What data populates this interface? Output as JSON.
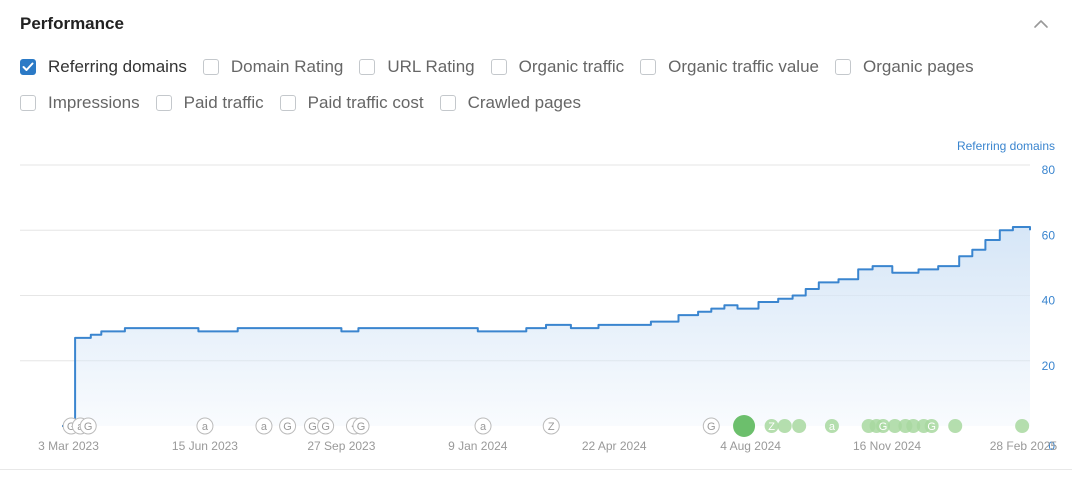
{
  "header": {
    "title": "Performance"
  },
  "metrics": [
    {
      "label": "Referring domains",
      "checked": true
    },
    {
      "label": "Domain Rating",
      "checked": false
    },
    {
      "label": "URL Rating",
      "checked": false
    },
    {
      "label": "Organic traffic",
      "checked": false
    },
    {
      "label": "Organic traffic value",
      "checked": false
    },
    {
      "label": "Organic pages",
      "checked": false
    },
    {
      "label": "Impressions",
      "checked": false
    },
    {
      "label": "Paid traffic",
      "checked": false
    },
    {
      "label": "Paid traffic cost",
      "checked": false
    },
    {
      "label": "Crawled pages",
      "checked": false
    }
  ],
  "colors": {
    "accent": "#2b7ac6",
    "line": "#3a85cf",
    "area": "#d6e6f7",
    "event_green": "#5cb85c"
  },
  "chart_data": {
    "type": "area",
    "series": [
      {
        "name": "Referring domains",
        "x": [
          "2023-02-26",
          "2023-03-05",
          "2023-03-08",
          "2023-03-20",
          "2023-03-28",
          "2023-04-15",
          "2023-05-01",
          "2023-06-10",
          "2023-07-10",
          "2023-08-01",
          "2023-09-27",
          "2023-10-10",
          "2023-11-15",
          "2023-12-20",
          "2024-01-09",
          "2024-02-15",
          "2024-03-01",
          "2024-03-20",
          "2024-04-10",
          "2024-05-20",
          "2024-06-01",
          "2024-06-10",
          "2024-06-25",
          "2024-07-05",
          "2024-07-15",
          "2024-07-25",
          "2024-08-10",
          "2024-08-25",
          "2024-09-05",
          "2024-09-15",
          "2024-09-25",
          "2024-10-10",
          "2024-10-25",
          "2024-11-05",
          "2024-11-20",
          "2024-12-10",
          "2024-12-25",
          "2025-01-10",
          "2025-01-20",
          "2025-01-30",
          "2025-02-10",
          "2025-02-20",
          "2025-03-05"
        ],
        "y": [
          0,
          0,
          27,
          28,
          29,
          30,
          30,
          29,
          30,
          30,
          29,
          30,
          30,
          30,
          29,
          30,
          31,
          30,
          31,
          32,
          32,
          34,
          35,
          36,
          37,
          36,
          38,
          39,
          40,
          42,
          44,
          45,
          48,
          49,
          47,
          48,
          49,
          52,
          54,
          57,
          60,
          61,
          60
        ]
      }
    ],
    "x_ticks": [
      "3 Mar 2023",
      "15 Jun 2023",
      "27 Sep 2023",
      "9 Jan 2024",
      "22 Apr 2024",
      "4 Aug 2024",
      "16 Nov 2024",
      "28 Feb 2025"
    ],
    "x_tick_dates": [
      "2023-03-03",
      "2023-06-15",
      "2023-09-27",
      "2024-01-09",
      "2024-04-22",
      "2024-08-04",
      "2024-11-16",
      "2025-02-28"
    ],
    "y_ticks": [
      "0",
      "20",
      "40",
      "60",
      "80"
    ],
    "ylim": [
      0,
      80
    ],
    "ylabel": "Referring domains",
    "xlim": [
      "2023-01-25",
      "2025-03-05"
    ],
    "grid": true,
    "events": [
      {
        "date": "2023-03-05",
        "glyph": "G",
        "style": "outline"
      },
      {
        "date": "2023-03-12",
        "glyph": "a",
        "style": "outline"
      },
      {
        "date": "2023-03-18",
        "glyph": "G",
        "style": "outline"
      },
      {
        "date": "2023-06-15",
        "glyph": "a",
        "style": "outline"
      },
      {
        "date": "2023-07-30",
        "glyph": "a",
        "style": "outline"
      },
      {
        "date": "2023-08-17",
        "glyph": "G",
        "style": "outline"
      },
      {
        "date": "2023-09-05",
        "glyph": "G",
        "style": "outline"
      },
      {
        "date": "2023-09-15",
        "glyph": "G",
        "style": "outline"
      },
      {
        "date": "2023-10-07",
        "glyph": "<",
        "style": "outline"
      },
      {
        "date": "2023-10-12",
        "glyph": "G",
        "style": "outline"
      },
      {
        "date": "2024-01-13",
        "glyph": "a",
        "style": "outline"
      },
      {
        "date": "2024-03-05",
        "glyph": "Z",
        "style": "outline"
      },
      {
        "date": "2024-07-05",
        "glyph": "G",
        "style": "outline"
      },
      {
        "date": "2024-07-30",
        "glyph": "",
        "style": "big"
      },
      {
        "date": "2024-08-20",
        "glyph": "Z",
        "style": "green"
      },
      {
        "date": "2024-08-30",
        "glyph": "",
        "style": "green"
      },
      {
        "date": "2024-09-10",
        "glyph": "",
        "style": "green"
      },
      {
        "date": "2024-10-05",
        "glyph": "a",
        "style": "green"
      },
      {
        "date": "2024-11-02",
        "glyph": "",
        "style": "green"
      },
      {
        "date": "2024-11-08",
        "glyph": "",
        "style": "green"
      },
      {
        "date": "2024-11-13",
        "glyph": "G",
        "style": "green"
      },
      {
        "date": "2024-11-22",
        "glyph": "",
        "style": "green"
      },
      {
        "date": "2024-11-30",
        "glyph": "",
        "style": "green"
      },
      {
        "date": "2024-12-06",
        "glyph": "",
        "style": "green"
      },
      {
        "date": "2024-12-14",
        "glyph": "",
        "style": "green"
      },
      {
        "date": "2024-12-20",
        "glyph": "G",
        "style": "green"
      },
      {
        "date": "2025-01-07",
        "glyph": "",
        "style": "green"
      },
      {
        "date": "2025-02-27",
        "glyph": "",
        "style": "green"
      }
    ]
  }
}
